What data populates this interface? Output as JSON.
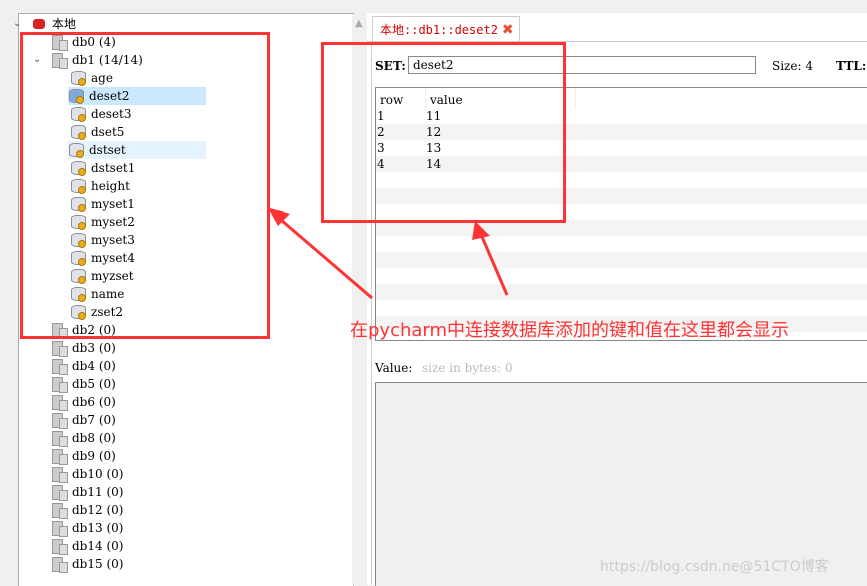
{
  "tree": {
    "root": {
      "label": "本地",
      "expanded": true
    },
    "databases": [
      {
        "label": "db0 (4)"
      },
      {
        "label": "db1  (14/14)",
        "expanded": true
      },
      {
        "label": "db2 (0)"
      },
      {
        "label": "db3 (0)"
      },
      {
        "label": "db4 (0)"
      },
      {
        "label": "db5 (0)"
      },
      {
        "label": "db6 (0)"
      },
      {
        "label": "db7 (0)"
      },
      {
        "label": "db8 (0)"
      },
      {
        "label": "db9 (0)"
      },
      {
        "label": "db10 (0)"
      },
      {
        "label": "db11 (0)"
      },
      {
        "label": "db12 (0)"
      },
      {
        "label": "db13 (0)"
      },
      {
        "label": "db14 (0)"
      },
      {
        "label": "db15 (0)"
      }
    ],
    "keys": [
      "age",
      "deset2",
      "deset3",
      "dset5",
      "dstset",
      "dstset1",
      "height",
      "myset1",
      "myset2",
      "myset3",
      "myset4",
      "myzset",
      "name",
      "zset2"
    ],
    "selected_key": "deset2",
    "hovered_key": "dstset"
  },
  "tab": {
    "label": "本地::db1::deset2",
    "close_icon": "close-x-icon"
  },
  "key_view": {
    "type_label": "SET:",
    "key_value": "deset2",
    "size_label": "Size: 4",
    "ttl_label": "TTL:",
    "columns": [
      "row",
      "value"
    ],
    "rows": [
      [
        "1",
        "11"
      ],
      [
        "2",
        "12"
      ],
      [
        "3",
        "13"
      ],
      [
        "4",
        "14"
      ]
    ],
    "value_label": "Value:",
    "value_hint": "size in bytes: 0"
  },
  "annotation": {
    "text": "在pycharm中连接数据库添加的键和值在这里都会显示",
    "color": "#ff3333"
  },
  "watermark": "https://blog.csdn.ne@51CTO博客"
}
